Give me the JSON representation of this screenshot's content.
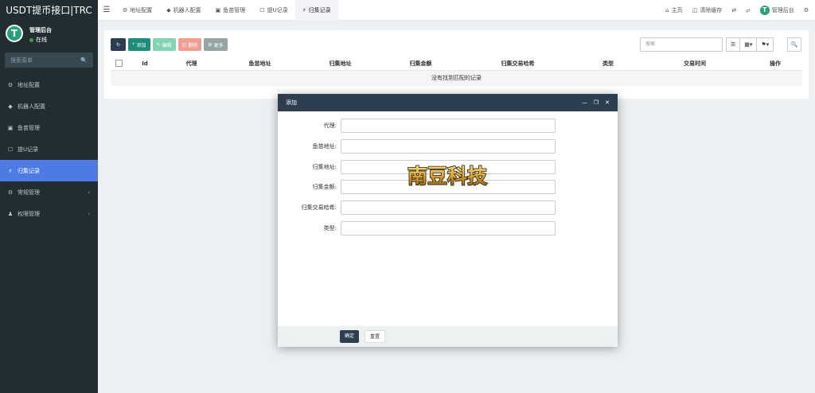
{
  "app": {
    "title": "USDT提币接口|TRC"
  },
  "user": {
    "name": "管理后台",
    "status": "在线"
  },
  "sidebar": {
    "search_placeholder": "搜索菜单",
    "items": [
      {
        "label": "地址配置",
        "icon": "gear-icon"
      },
      {
        "label": "机器人配置",
        "icon": "diamond-icon"
      },
      {
        "label": "鱼苗管理",
        "icon": "lock-icon"
      },
      {
        "label": "提U记录",
        "icon": "bookmark-icon"
      },
      {
        "label": "归集记录",
        "icon": "bolt-icon",
        "active": true
      },
      {
        "label": "常规管理",
        "icon": "cogs-icon",
        "has_children": true
      },
      {
        "label": "权限管理",
        "icon": "users-icon",
        "has_children": true
      }
    ]
  },
  "topbar": {
    "tabs": [
      {
        "label": "地址配置",
        "icon": "gear-icon"
      },
      {
        "label": "机器人配置",
        "icon": "diamond-icon"
      },
      {
        "label": "鱼苗管理",
        "icon": "lock-icon"
      },
      {
        "label": "提U记录",
        "icon": "bookmark-icon"
      },
      {
        "label": "归集记录",
        "icon": "bolt-icon",
        "active": true
      }
    ],
    "home": "主页",
    "clear_cache": "清除缓存",
    "admin": "管理后台"
  },
  "toolbar": {
    "add": "添加",
    "edit": "编辑",
    "delete": "删除",
    "more": "更多",
    "search_placeholder": "搜索"
  },
  "table": {
    "columns": [
      "Id",
      "代理",
      "鱼苗地址",
      "归集地址",
      "归集金额",
      "归集交易哈希",
      "类型",
      "交易时间",
      "操作"
    ],
    "empty_text": "没有找到匹配的记录"
  },
  "modal": {
    "title": "添加",
    "fields": [
      {
        "label": "代理:",
        "value": ""
      },
      {
        "label": "鱼苗地址:",
        "value": ""
      },
      {
        "label": "归集地址:",
        "value": ""
      },
      {
        "label": "归集金额:",
        "value": ""
      },
      {
        "label": "归集交易哈希:",
        "value": ""
      },
      {
        "label": "类型:",
        "value": ""
      }
    ],
    "watermark": "南豆科技",
    "ok": "确定",
    "reset": "重置"
  },
  "colors": {
    "sidebar_bg": "#222d32",
    "active_menu": "#4d7ae3",
    "modal_header": "#2c3e50",
    "tether": "#26a17b"
  }
}
